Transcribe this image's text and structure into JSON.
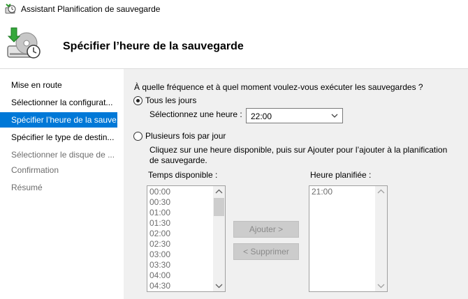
{
  "window": {
    "title": "Assistant Planification de sauvegarde"
  },
  "header": {
    "title": "Spécifier l’heure de la sauvegarde"
  },
  "sidebar": {
    "items": [
      {
        "label": "Mise en route",
        "state": "normal"
      },
      {
        "label": "Sélectionner la configurat...",
        "state": "normal"
      },
      {
        "label": "Spécifier l’heure de la sauve...",
        "state": "active"
      },
      {
        "label": "Spécifier le type de destin...",
        "state": "normal"
      },
      {
        "label": "Sélectionner le disque de ...",
        "state": "disabled"
      },
      {
        "label": "Confirmation",
        "state": "disabled"
      },
      {
        "label": "Résumé",
        "state": "disabled"
      }
    ]
  },
  "main": {
    "question": "À quelle fréquence et à quel moment voulez-vous exécuter les sauvegardes ?",
    "option_daily": {
      "label": "Tous les jours",
      "selected": true
    },
    "select_time": {
      "label": "Sélectionnez une heure :",
      "value": "22:00"
    },
    "option_multiple": {
      "label": "Plusieurs fois par jour",
      "selected": false
    },
    "instruction_line1": "Cliquez sur une heure disponible, puis sur Ajouter pour l’ajouter à la planification",
    "instruction_line2": "de sauvegarde.",
    "available": {
      "label": "Temps disponible :",
      "items": [
        "00:00",
        "00:30",
        "01:00",
        "01:30",
        "02:00",
        "02:30",
        "03:00",
        "03:30",
        "04:00",
        "04:30"
      ]
    },
    "scheduled": {
      "label": "Heure planifiée :",
      "items": [
        "21:00"
      ]
    },
    "add_button": "Ajouter >",
    "remove_button": "< Supprimer"
  }
}
